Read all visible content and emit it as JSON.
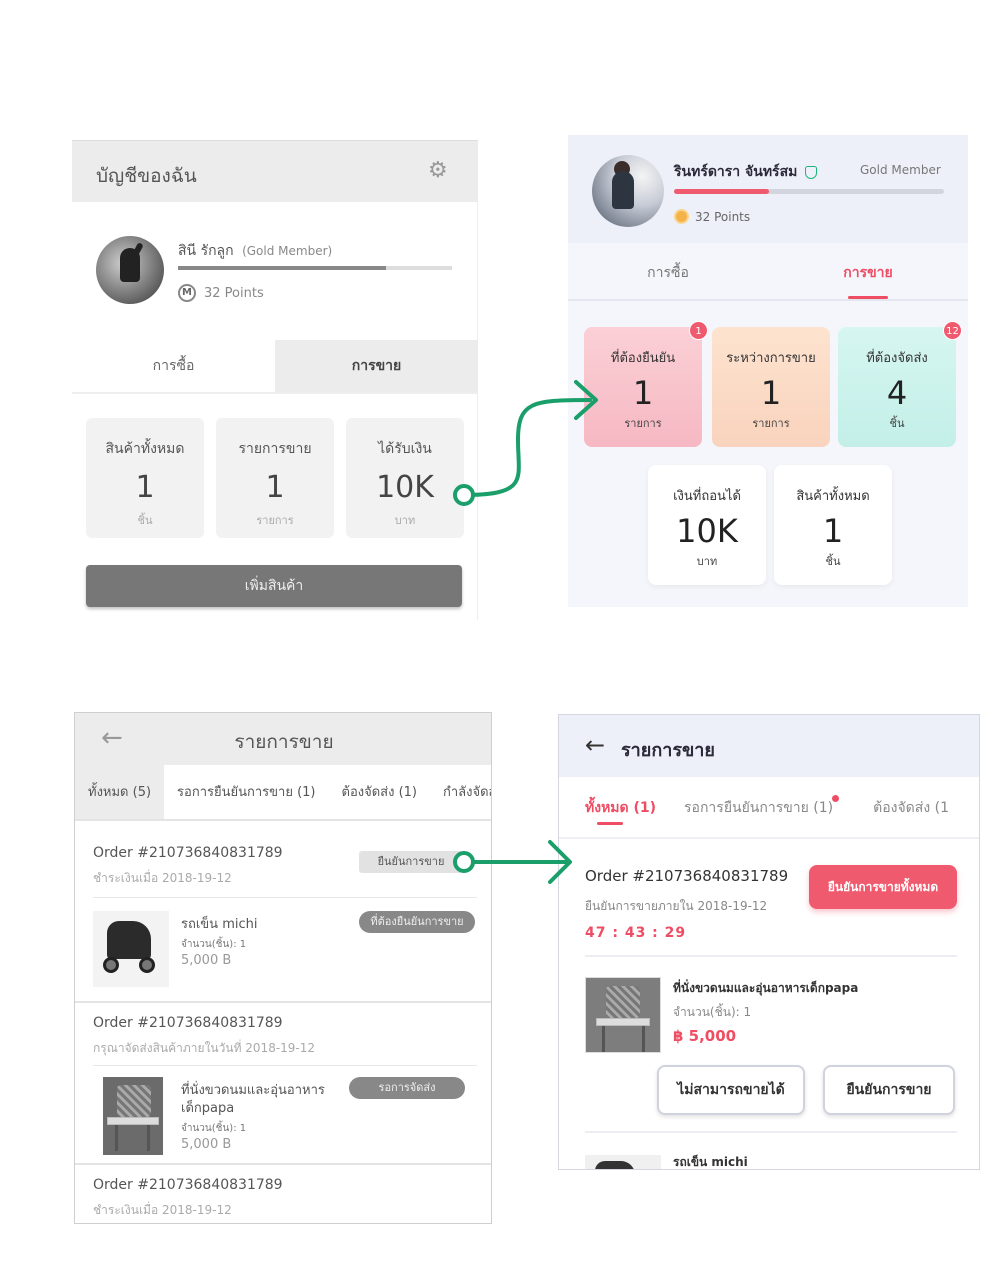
{
  "colors": {
    "accent": "#ee4d63",
    "green_arrow": "#1a9e6a",
    "wire_gray": "#777777"
  },
  "wireframe_account": {
    "title": "บัญชีของฉัน",
    "settings_icon": "gear-icon",
    "user_name": "สินี รักลูก",
    "member_tag": "(Gold Member)",
    "points_icon": "m",
    "points": "32 Points",
    "progress_fraction": 0.76,
    "tabs": [
      "การซื้อ",
      "การขาย"
    ],
    "stats": [
      {
        "label": "สินค้าทั้งหมด",
        "value": "1",
        "unit": "ชิ้น"
      },
      {
        "label": "รายการขาย",
        "value": "1",
        "unit": "รายการ"
      },
      {
        "label": "ได้รับเงิน",
        "value": "10K",
        "unit": "บาท"
      }
    ],
    "add_button": "เพิ่มสินค้า"
  },
  "designed_account": {
    "user_name": "รินทร์ดารา จันทร์สม",
    "member_tag": "Gold Member",
    "points": "32 Points",
    "progress_fraction": 0.35,
    "tabs": [
      "การซื้อ",
      "การขาย"
    ],
    "stats_top": [
      {
        "label": "ที่ต้องยืนยัน",
        "value": "1",
        "unit": "รายการ",
        "badge": "1"
      },
      {
        "label": "ระหว่างการขาย",
        "value": "1",
        "unit": "รายการ",
        "badge": ""
      },
      {
        "label": "ที่ต้องจัดส่ง",
        "value": "4",
        "unit": "ชิ้น",
        "badge": "12"
      }
    ],
    "stats_bottom": [
      {
        "label": "เงินที่ถอนได้",
        "value": "10K",
        "unit": "บาท"
      },
      {
        "label": "สินค้าทั้งหมด",
        "value": "1",
        "unit": "ชิ้น"
      }
    ]
  },
  "wireframe_sales": {
    "back_icon": "←",
    "title": "รายการขาย",
    "tabs": [
      "ทั้งหมด (5)",
      "รอการยืนยันการขาย (1)",
      "ต้องจัดส่ง (1)",
      "กำลังจัดส่ง"
    ],
    "orders": [
      {
        "order_no": "Order #210736840831789",
        "sub": "ชำระเงินเมื่อ 2018-19-12",
        "action_pill": "ยืนยันการขาย",
        "status_pill": "ที่ต้องยืนยันการขาย",
        "product": "รถเข็น michi",
        "qty": "จำนวน(ชิ้น): 1",
        "price": "5,000 B"
      },
      {
        "order_no": "Order #210736840831789",
        "sub": "กรุณาจัดส่งสินค้าภายในวันที่ 2018-19-12",
        "status_pill": "รอการจัดส่ง",
        "product_line1": "ที่นั่งขวดนมและอุ่นอาหาร",
        "product_line2": "เด็กpapa",
        "qty": "จำนวน(ชิ้น): 1",
        "price": "5,000 B"
      },
      {
        "order_no": "Order #210736840831789",
        "sub": "ชำระเงินเมื่อ 2018-19-12"
      }
    ]
  },
  "designed_sales": {
    "back_icon": "←",
    "title": "รายการขาย",
    "tabs": [
      "ทั้งหมด (1)",
      "รอการยืนยันการขาย (1)",
      "ต้องจัดส่ง (1"
    ],
    "order_no": "Order #210736840831789",
    "sub": "ยืนยันการขายภายใน 2018-19-12",
    "timer": "47 : 43 : 29",
    "confirm_all": "ยืนยันการขายทั้งหมด",
    "product": "ที่นั่งขวดนมและอุ่นอาหารเด็กpapa",
    "qty": "จำนวน(ชิ้น): 1",
    "price": "฿ 5,000",
    "reject_button": "ไม่สามารถขายได้",
    "confirm_button": "ยืนยันการขาย",
    "next_product": "รถเข็น michi"
  }
}
